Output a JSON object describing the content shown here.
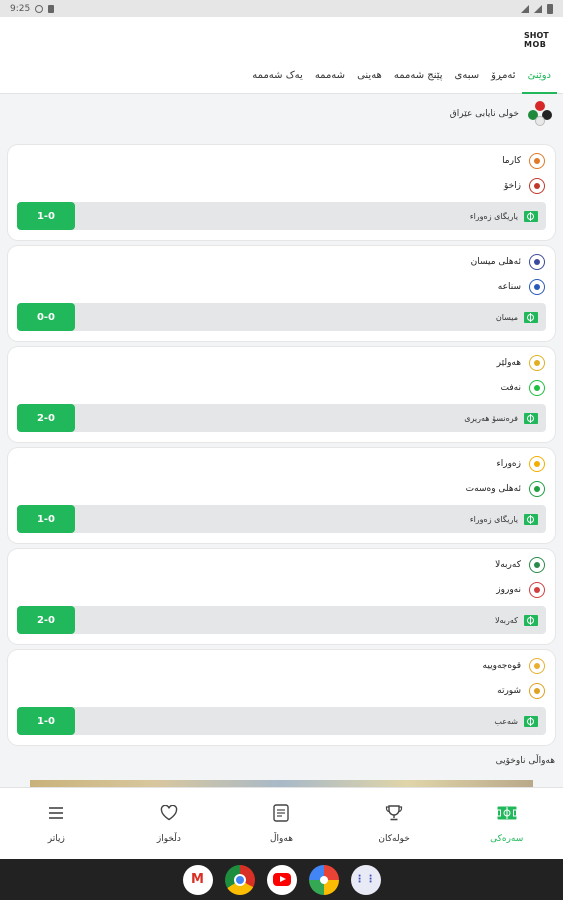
{
  "status_bar": {
    "time": "9:25"
  },
  "app": {
    "logo_line1": "SHOT",
    "logo_line2": "MOB"
  },
  "tabs": [
    {
      "label": "دوێنێ",
      "active": true
    },
    {
      "label": "ئەمڕۆ",
      "active": false
    },
    {
      "label": "سبەی",
      "active": false
    },
    {
      "label": "پێنج شەممە",
      "active": false
    },
    {
      "label": "هەینی",
      "active": false
    },
    {
      "label": "شەممە",
      "active": false
    },
    {
      "label": "یەک شەممە",
      "active": false
    }
  ],
  "league": {
    "name": "خولی نایابی عێراق"
  },
  "matches": [
    {
      "home": "کارما",
      "away": "زاخۆ",
      "stadium": "یاریگای زەوراء",
      "score": "1-0",
      "home_color": "#e07a2a",
      "away_color": "#c0392b"
    },
    {
      "home": "ئەهلی میسان",
      "away": "سناعە",
      "stadium": "میسان",
      "score": "0-0",
      "home_color": "#3b4a9a",
      "away_color": "#2a5ab8"
    },
    {
      "home": "هەولێر",
      "away": "نەفت",
      "stadium": "فرەنسۆ هەریری",
      "score": "2-0",
      "home_color": "#e0b020",
      "away_color": "#20c040"
    },
    {
      "home": "زەوراء",
      "away": "ئەهلی وەسەت",
      "stadium": "یاریگای زەوراء",
      "score": "1-0",
      "home_color": "#f0b000",
      "away_color": "#20a040"
    },
    {
      "home": "کەربەلا",
      "away": "نەوروز",
      "stadium": "کەربەلا",
      "score": "2-0",
      "home_color": "#2a8a4a",
      "away_color": "#d04040"
    },
    {
      "home": "قوەجەوییە",
      "away": "شورتە",
      "stadium": "شەعب",
      "score": "1-0",
      "home_color": "#e8b030",
      "away_color": "#e0a020"
    }
  ],
  "news_section": {
    "title": "هەواڵی ناوخۆیی"
  },
  "bottom_nav": [
    {
      "label": "سەرەکی",
      "icon": "pitch-icon",
      "active": true
    },
    {
      "label": "خولەکان",
      "icon": "trophy-icon",
      "active": false
    },
    {
      "label": "هەواڵ",
      "icon": "news-icon",
      "active": false
    },
    {
      "label": "دڵخواز",
      "icon": "heart-icon",
      "active": false
    },
    {
      "label": "زیاتر",
      "icon": "menu-icon",
      "active": false
    }
  ],
  "dock_apps": [
    "gmail-icon",
    "chrome-icon",
    "youtube-icon",
    "photos-icon",
    "apps-icon"
  ],
  "colors": {
    "accent": "#20b85a",
    "card_bar": "#e4e6e8"
  }
}
